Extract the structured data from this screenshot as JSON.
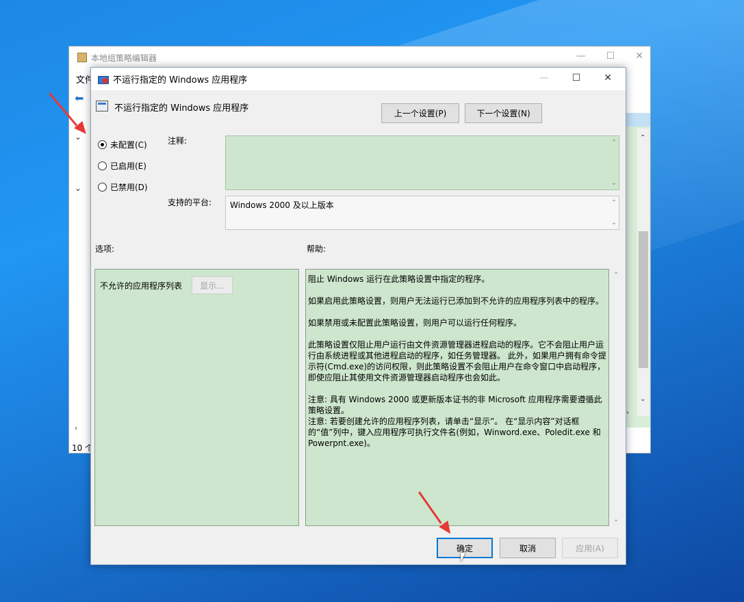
{
  "bg_window": {
    "title": "本地组策略编辑器",
    "menu_first": "文件",
    "status": "10 个设置"
  },
  "dialog": {
    "title": "不运行指定的 Windows 应用程序",
    "heading": "不运行指定的 Windows 应用程序",
    "prev_button": "上一个设置(P)",
    "next_button": "下一个设置(N)",
    "radios": [
      {
        "label": "未配置(C)",
        "checked": true
      },
      {
        "label": "已启用(E)",
        "checked": false
      },
      {
        "label": "已禁用(D)",
        "checked": false
      }
    ],
    "comment_label": "注释:",
    "platform_label": "支持的平台:",
    "platform_value": "Windows 2000 及以上版本",
    "options_label": "选项:",
    "help_label": "帮助:",
    "option_item_label": "不允许的应用程序列表",
    "show_button": "显示...",
    "help_paragraphs": [
      "阻止 Windows 运行在此策略设置中指定的程序。",
      "如果启用此策略设置，则用户无法运行已添加到不允许的应用程序列表中的程序。",
      "如果禁用或未配置此策略设置，则用户可以运行任何程序。",
      "此策略设置仅阻止用户运行由文件资源管理器进程启动的程序。它不会阻止用户运行由系统进程或其他进程启动的程序，如任务管理器。 此外，如果用户拥有命令提示符(Cmd.exe)的访问权限，则此策略设置不会阻止用户在命令窗口中启动程序，即使应阻止其使用文件资源管理器启动程序也会如此。",
      "注意: 具有 Windows 2000 或更新版本证书的非 Microsoft 应用程序需要遵循此策略设置。",
      "注意: 若要创建允许的应用程序列表，请单击“显示”。 在“显示内容”对话框的“值”列中，键入应用程序可执行文件名(例如，Winword.exe、Poledit.exe 和 Powerpnt.exe)。"
    ],
    "ok_button": "确定",
    "cancel_button": "取消",
    "apply_button": "应用(A)"
  },
  "colors": {
    "desktop": "#1e88e5",
    "policy_green": "#cde6cd",
    "annotation_red": "#e53935",
    "focus_blue": "#0078d7"
  }
}
